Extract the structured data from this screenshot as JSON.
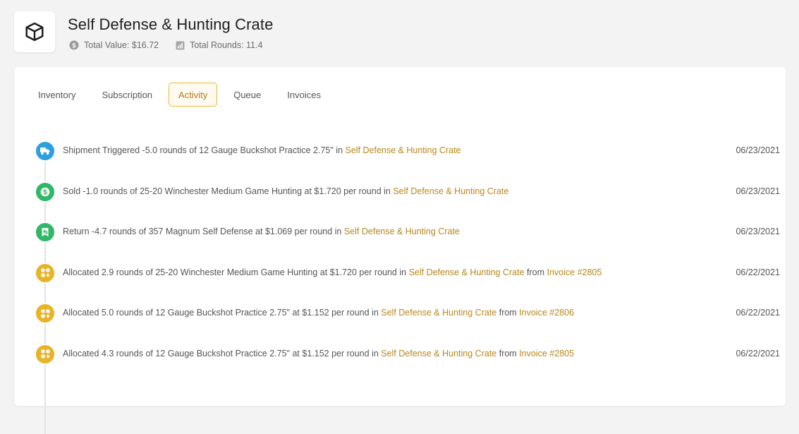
{
  "header": {
    "title": "Self Defense & Hunting Crate",
    "total_value": "Total Value: $16.72",
    "total_rounds": "Total Rounds: 11.4"
  },
  "tabs": [
    {
      "label": "Inventory",
      "active": false
    },
    {
      "label": "Subscription",
      "active": false
    },
    {
      "label": "Activity",
      "active": true
    },
    {
      "label": "Queue",
      "active": false
    },
    {
      "label": "Invoices",
      "active": false
    }
  ],
  "colors": {
    "accent": "#e8b93a",
    "link": "#b8871a",
    "blue": "#2d9fe0",
    "green": "#2fb866",
    "yellow": "#e8b325"
  },
  "activity": [
    {
      "icon": "truck-icon",
      "color": "blue",
      "text": "Shipment Triggered -5.0 rounds of 12 Gauge Buckshot Practice 2.75\" in ",
      "crate_link": "Self Defense & Hunting Crate",
      "from": "",
      "invoice_link": "",
      "date": "06/23/2021"
    },
    {
      "icon": "dollar-icon",
      "color": "green",
      "text": "Sold -1.0 rounds of 25-20 Winchester Medium Game Hunting at $1.720 per round in ",
      "crate_link": "Self Defense & Hunting Crate",
      "from": "",
      "invoice_link": "",
      "date": "06/23/2021"
    },
    {
      "icon": "return-icon",
      "color": "green",
      "text": "Return -4.7 rounds of 357 Magnum Self Defense at $1.069 per round in ",
      "crate_link": "Self Defense & Hunting Crate",
      "from": "",
      "invoice_link": "",
      "date": "06/23/2021"
    },
    {
      "icon": "allocate-icon",
      "color": "yellow",
      "text": "Allocated 2.9 rounds of 25-20 Winchester Medium Game Hunting at $1.720 per round in ",
      "crate_link": "Self Defense & Hunting Crate",
      "from": " from ",
      "invoice_link": "Invoice #2805",
      "date": "06/22/2021"
    },
    {
      "icon": "allocate-icon",
      "color": "yellow",
      "text": "Allocated 5.0 rounds of 12 Gauge Buckshot Practice 2.75\" at $1.152 per round in ",
      "crate_link": "Self Defense & Hunting Crate",
      "from": " from ",
      "invoice_link": "Invoice #2806",
      "date": "06/22/2021"
    },
    {
      "icon": "allocate-icon",
      "color": "yellow",
      "text": "Allocated 4.3 rounds of 12 Gauge Buckshot Practice 2.75\" at $1.152 per round in ",
      "crate_link": "Self Defense & Hunting Crate",
      "from": " from ",
      "invoice_link": "Invoice #2805",
      "date": "06/22/2021"
    }
  ]
}
